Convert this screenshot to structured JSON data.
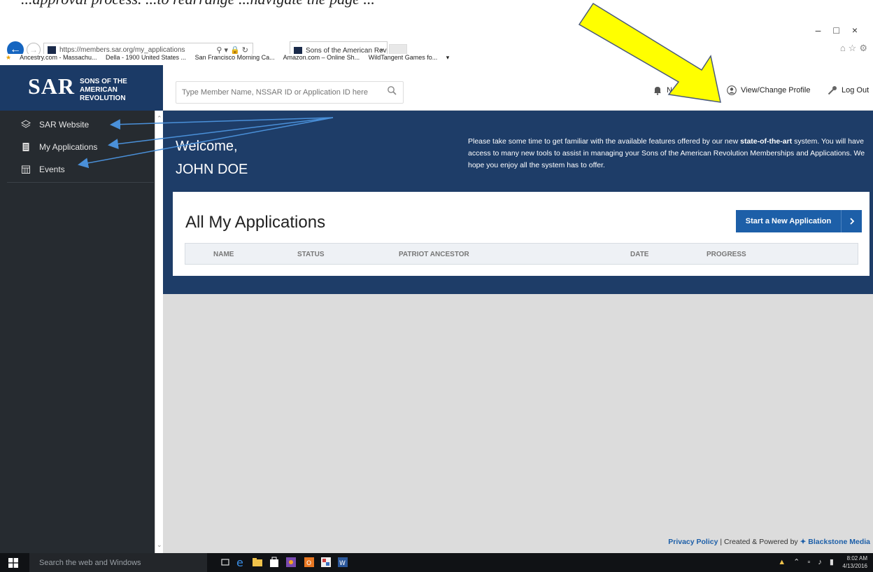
{
  "caption": {
    "text": "...approval process. ...to rearrange ...navigate the page ..."
  },
  "browser": {
    "url": "https://members.sar.org/my_applications",
    "tab_title": "Sons of the American Revol...",
    "favorites": [
      "Ancestry.com - Massachu...",
      "Della - 1900 United States ...",
      "San Francisco Morning Ca...",
      "Amazon.com – Online Sh...",
      "WildTangent Games fo..."
    ]
  },
  "header": {
    "logo_main": "SAR",
    "logo_sub_line1": "SONS OF THE",
    "logo_sub_line2": "AMERICAN REVOLUTION",
    "search_placeholder": "Type Member Name, NSSAR ID or Application ID here",
    "notifications": "Notifications",
    "profile": "View/Change Profile",
    "logout": "Log Out"
  },
  "sidebar": {
    "items": [
      {
        "label": "SAR Website",
        "icon": "layers-icon"
      },
      {
        "label": "My Applications",
        "icon": "document-icon"
      },
      {
        "label": "Events",
        "icon": "calendar-icon"
      }
    ]
  },
  "hero": {
    "welcome": "Welcome,",
    "username": "JOHN DOE",
    "intro_pre": "Please take some time to get familiar with the available features offered by our new ",
    "intro_bold": "state-of-the-art",
    "intro_post": " system. You will have access to many new tools to assist in managing your Sons of the American Revolution Memberships and Applications. We hope you enjoy all the system has to offer."
  },
  "applications": {
    "title": "All My Applications",
    "new_button": "Start a New Application",
    "columns": [
      "NAME",
      "STATUS",
      "PATRIOT ANCESTOR",
      "DATE",
      "PROGRESS"
    ]
  },
  "footer": {
    "privacy": "Privacy Policy",
    "separator": " | Created & Powered by ",
    "brand": "Blackstone Media"
  },
  "taskbar": {
    "search_placeholder": "Search the web and Windows",
    "time": "8:02 AM",
    "date": "4/13/2016"
  },
  "colors": {
    "navy": "#1b3a66",
    "hero": "#1e3d68",
    "sidebar": "#262b30",
    "button": "#1d5fa8",
    "annotation_yellow": "#ffff00",
    "annotation_blue": "#4a90d9"
  }
}
